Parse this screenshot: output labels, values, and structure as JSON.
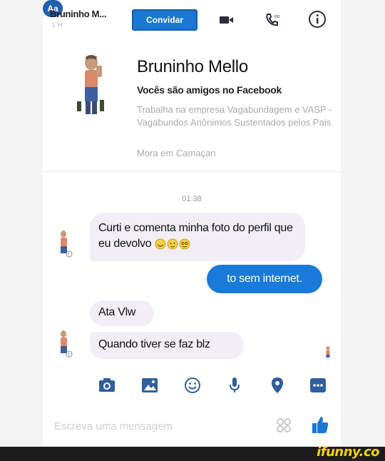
{
  "header": {
    "contact_name": "Bruninho M...",
    "last_active": "1 H",
    "invite_label": "Convidar"
  },
  "profile": {
    "name": "Bruninho Mello",
    "friends_text": "Vocês são amigos no Facebook",
    "work": "Trabalha na empresa Vagabundagem e VASP - Vagabundos Anônimos Sustentados pelos Pais",
    "city": "Mora em Camaçari"
  },
  "chat": {
    "timestamp": "01:38",
    "messages": [
      {
        "from": "contact",
        "text": "Curti e comenta minha foto do perfil que eu devolvo"
      },
      {
        "from": "me",
        "text": "to sem internet."
      },
      {
        "from": "contact",
        "text": "Ata Vlw"
      },
      {
        "from": "contact",
        "text": "Quando tiver se faz blz"
      }
    ]
  },
  "toolbar": {
    "text_style_label": "Aa",
    "icons": [
      "text-style-icon",
      "camera-icon",
      "gallery-icon",
      "emoji-icon",
      "microphone-icon",
      "location-icon",
      "more-icon"
    ]
  },
  "composer": {
    "placeholder": "Escreva uma mensagem"
  },
  "watermark": "ifunny.co",
  "colors": {
    "accent": "#1a78d3",
    "outgoing_bubble": "#1a7ad9",
    "incoming_bubble": "#f1eef5",
    "watermark_bar": "#1c1c1c",
    "watermark_text": "#f7d200"
  }
}
